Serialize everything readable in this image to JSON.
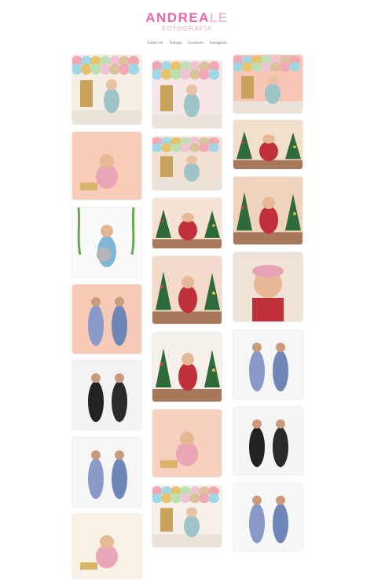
{
  "header": {
    "logo_bold": "ANDREA",
    "logo_light": "LE",
    "subtitle": "FOTOGRAFÍA"
  },
  "nav": {
    "items": [
      "Sobre mí",
      "Trabajo",
      "Contacto",
      "Instagram"
    ]
  },
  "gallery": {
    "photos": [
      {
        "name": "first-birthday-cake-smash-photo",
        "scene": "birthday",
        "bg": "#f4eee4"
      },
      {
        "name": "baby-pink-dress-toys-photo",
        "scene": "baby",
        "bg": "#f7cdb8"
      },
      {
        "name": "toddler-striped-shirt-ivy-photo",
        "scene": "boy",
        "bg": "#fafafa"
      },
      {
        "name": "woman-lilac-dress-duo-photo",
        "scene": "duo",
        "bg": "#f7c9b7"
      },
      {
        "name": "women-black-bodysuit-photo",
        "scene": "dark-duo",
        "bg": "#f3f3f3"
      },
      {
        "name": "women-white-tops-jeans-photo",
        "scene": "duo",
        "bg": "#f6f6f6"
      },
      {
        "name": "baby-rainbow-rocker-photo",
        "scene": "baby",
        "bg": "#f7f1e6"
      },
      {
        "name": "cake-smash-balloons-photo",
        "scene": "birthday",
        "bg": "#f6e6e8"
      },
      {
        "name": "toddler-balloon-wall-photo",
        "scene": "birthday",
        "bg": "#f2e0d2"
      },
      {
        "name": "christmas-family-kids-photo",
        "scene": "christmas",
        "bg": "#f6e3d3"
      },
      {
        "name": "christmas-family-couple-photo",
        "scene": "christmas",
        "bg": "#f3dacb"
      },
      {
        "name": "mother-daughter-red-dress-photo",
        "scene": "christmas",
        "bg": "#f6f0ea"
      },
      {
        "name": "toddler-xylophone-photo",
        "scene": "baby",
        "bg": "#f8d0c0"
      },
      {
        "name": "birthday-boy-balloons-photo",
        "scene": "birthday",
        "bg": "#f7efe8"
      },
      {
        "name": "first-birthday-pastel-photo",
        "scene": "birthday",
        "bg": "#f8c6b4"
      },
      {
        "name": "christmas-girl-tree-photo",
        "scene": "christmas",
        "bg": "#f2dfcc"
      },
      {
        "name": "christmas-boy-plaid-shirt-photo",
        "scene": "christmas",
        "bg": "#f1d4c0"
      },
      {
        "name": "girl-red-dress-headband-photo",
        "scene": "portrait",
        "bg": "#efe3d8"
      },
      {
        "name": "women-denim-outfits-photo",
        "scene": "duo",
        "bg": "#f6f6f6"
      },
      {
        "name": "women-black-tops-jeans-photo",
        "scene": "dark-duo",
        "bg": "#f5f5f5"
      },
      {
        "name": "women-white-tops-jeans-2-photo",
        "scene": "duo",
        "bg": "#f7f7f7"
      }
    ]
  }
}
